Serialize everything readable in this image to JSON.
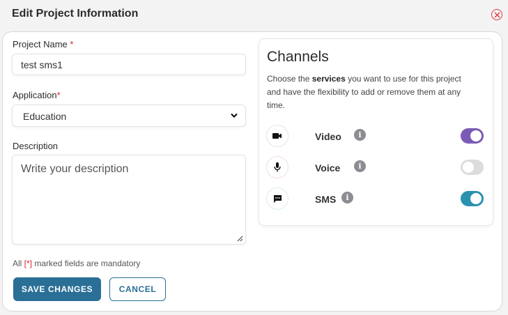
{
  "dialog": {
    "title": "Edit Project Information"
  },
  "form": {
    "project_name_label": "Project Name",
    "project_name_value": "test sms1",
    "application_label": "Application",
    "application_value": "Education",
    "description_label": "Description",
    "description_placeholder": "Write your description",
    "required_mark": "*",
    "mandatory_prefix": "All ",
    "mandatory_mark": "[*]",
    "mandatory_suffix": " marked fields are mandatory",
    "save_label": "SAVE CHANGES",
    "cancel_label": "CANCEL"
  },
  "channels": {
    "title": "Channels",
    "desc_before": "Choose the ",
    "desc_bold": "services",
    "desc_after": " you want to use for this project and have the flexibility to add or remove them at any time.",
    "items": [
      {
        "label": "Video",
        "icon": "video-camera-icon",
        "enabled": true,
        "accent": "#7b5ab6"
      },
      {
        "label": "Voice",
        "icon": "microphone-icon",
        "enabled": false,
        "accent": "#d6d6d8"
      },
      {
        "label": "SMS",
        "icon": "chat-icon",
        "enabled": true,
        "accent": "#2a92b0"
      }
    ]
  },
  "colors": {
    "primary": "#2a6f96",
    "required": "#d9232d",
    "close": "#e0393e"
  }
}
